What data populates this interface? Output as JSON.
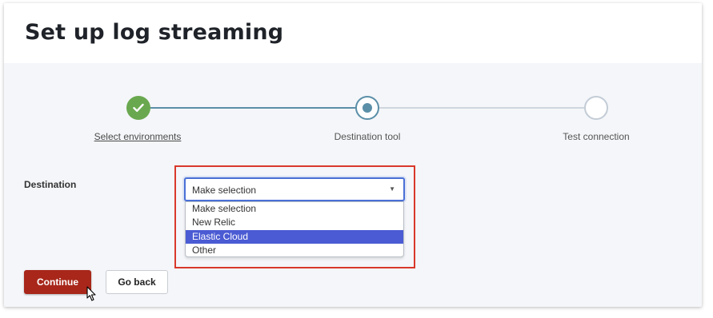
{
  "page": {
    "title": "Set up log streaming"
  },
  "stepper": {
    "steps": [
      {
        "label": "Select environments",
        "status": "completed"
      },
      {
        "label": "Destination tool",
        "status": "current"
      },
      {
        "label": "Test connection",
        "status": "upcoming"
      }
    ]
  },
  "form": {
    "destination_label": "Destination",
    "select_value": "Make selection",
    "caret_icon": "caret-down-icon",
    "options": [
      "Make selection",
      "New Relic",
      "Elastic Cloud",
      "Other"
    ],
    "highlighted_option": "Elastic Cloud"
  },
  "buttons": {
    "continue": "Continue",
    "go_back": "Go back"
  },
  "colors": {
    "primary_button": "#a8271a",
    "step_completed": "#6aa84f",
    "step_accent": "#5b8fa8",
    "option_highlight": "#4a5bd3",
    "annotation_box": "#d9382b"
  }
}
